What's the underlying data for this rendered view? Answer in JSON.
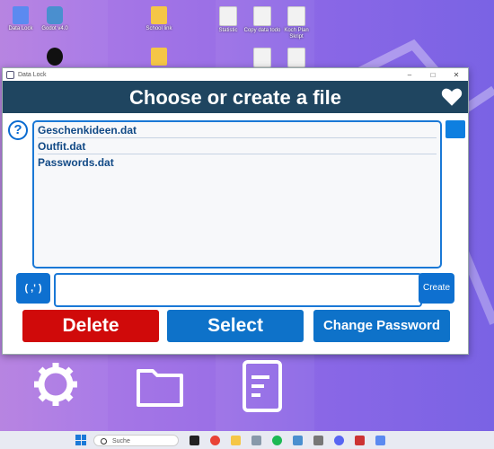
{
  "desktop": {
    "icons": [
      {
        "label": "Data Lock"
      },
      {
        "label": "Godot v4.0"
      },
      {
        "label": "School link"
      },
      {
        "label": "Statistic"
      },
      {
        "label": "Copy data todo"
      },
      {
        "label": "Koch Plan Skript"
      }
    ]
  },
  "window": {
    "titlebar_text": "Data Lock",
    "controls": [
      "–",
      "□",
      "✕"
    ],
    "header_title": "Choose or create a file",
    "help_glyph": "?",
    "files": [
      "Geschenkideen.dat",
      "Outfit.dat",
      "Passwords.dat"
    ],
    "small_button_label": "( ,' )",
    "filename_input_value": "",
    "create_label": "Create",
    "delete_label": "Delete",
    "select_label": "Select",
    "change_password_label": "Change Password",
    "colors": {
      "header": "#1f4560",
      "accent": "#0e72c9",
      "danger": "#d00a0a"
    }
  },
  "taskbar": {
    "search_placeholder": "Suche"
  }
}
